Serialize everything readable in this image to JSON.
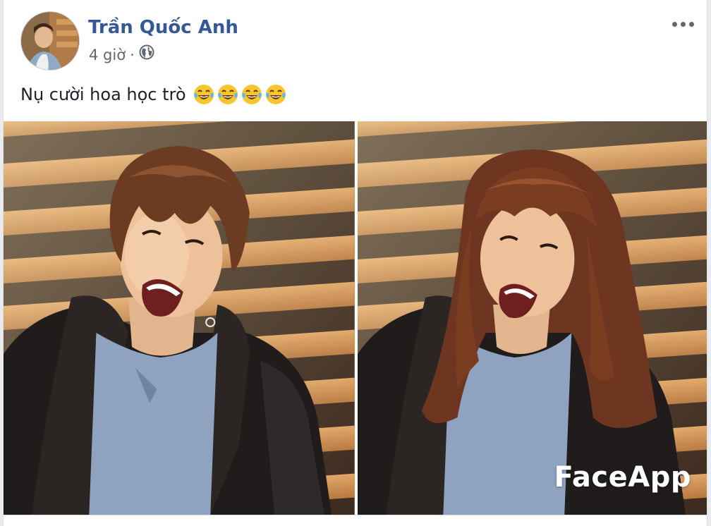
{
  "post": {
    "author": "Trần Quốc Anh",
    "timestamp": "4 giờ",
    "separator": "·",
    "privacy_icon": "globe-icon",
    "more_icon": "ellipsis-icon",
    "text": "Nụ cười hoa học trò",
    "emojis": [
      "laughing-tears-emoji",
      "laughing-tears-emoji",
      "laughing-tears-emoji",
      "laughing-tears-emoji"
    ],
    "photos": [
      {
        "name": "photo-original"
      },
      {
        "name": "photo-faceapp",
        "watermark": "FaceApp"
      }
    ]
  },
  "colors": {
    "author_link": "#365899",
    "meta_text": "#616770",
    "body_text": "#1d2129",
    "slat": "#c9874a",
    "shadow": "#3a2a1d"
  }
}
